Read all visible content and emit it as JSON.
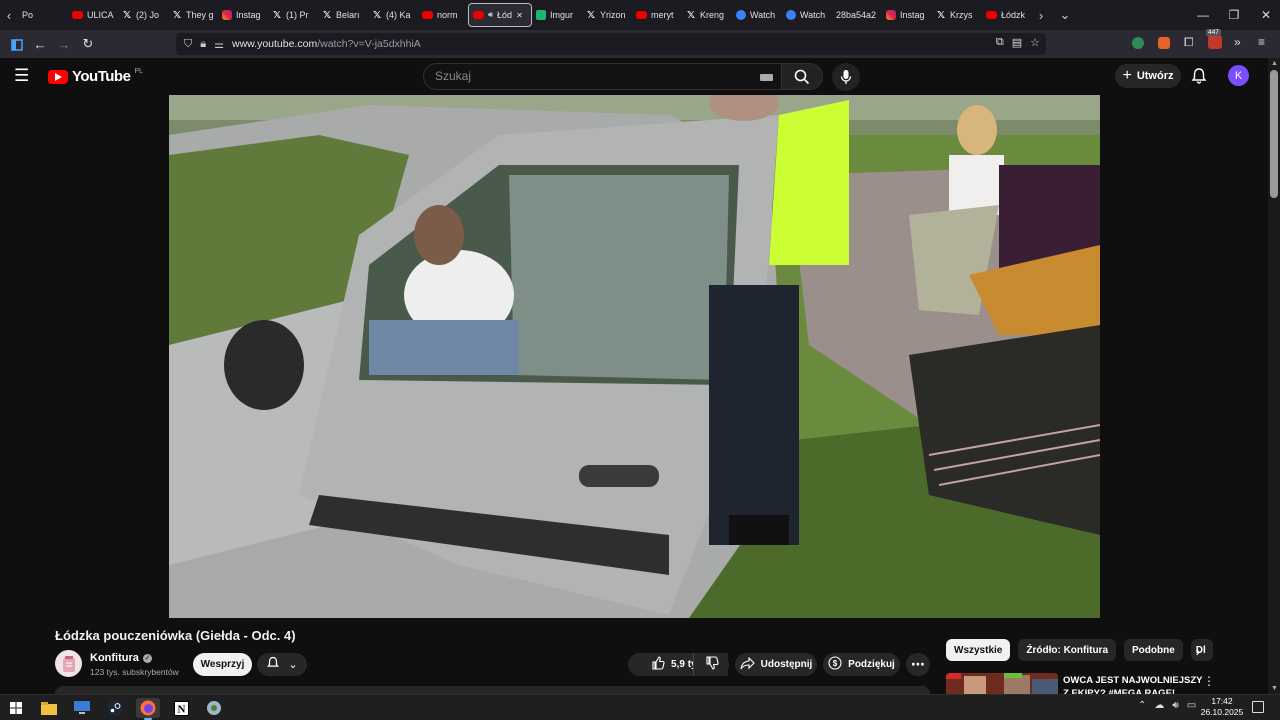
{
  "browser": {
    "tabs": [
      {
        "title": "Po",
        "icon": "none"
      },
      {
        "title": "ULICA",
        "icon": "youtube"
      },
      {
        "title": "(2) Jo",
        "icon": "x"
      },
      {
        "title": "They g",
        "icon": "x"
      },
      {
        "title": "Instag",
        "icon": "instagram"
      },
      {
        "title": "(1) Pr",
        "icon": "x"
      },
      {
        "title": "Beları",
        "icon": "x"
      },
      {
        "title": "(4) Ka",
        "icon": "x"
      },
      {
        "title": "norm",
        "icon": "youtube"
      },
      {
        "title": "Łód",
        "icon": "youtube",
        "active": true
      },
      {
        "title": "Imgur",
        "icon": "imgur"
      },
      {
        "title": "Yrizon",
        "icon": "x"
      },
      {
        "title": "meryt",
        "icon": "youtube"
      },
      {
        "title": "Kreng",
        "icon": "x"
      },
      {
        "title": "Watch",
        "icon": "edge"
      },
      {
        "title": "Watch",
        "icon": "edge"
      },
      {
        "title": "28ba54a2",
        "icon": "none"
      },
      {
        "title": "Instag",
        "icon": "instagram"
      },
      {
        "title": "Krzys",
        "icon": "x"
      },
      {
        "title": "Łódzk",
        "icon": "youtube"
      }
    ],
    "url_host": "www.youtube.com",
    "url_path": "/watch?v=V-ja5dxhhiA",
    "extension_badge": "447"
  },
  "youtube": {
    "logo_text": "YouTube",
    "region": "PL",
    "search_placeholder": "Szukaj",
    "create_label": "Utwórz",
    "avatar_letter": "K"
  },
  "video": {
    "title": "Łódzka pouczeniówka (Giełda - Odc. 4)",
    "channel_name": "Konfitura",
    "subscribers": "123 tys. subskrybentów",
    "support_label": "Wesprzyj",
    "likes": "5,9 tys.",
    "share_label": "Udostępnij",
    "thanks_label": "Podziękuj"
  },
  "sidebar": {
    "chips": [
      "Wszystkie",
      "Źródło: Konfitura",
      "Podobne",
      "Dl"
    ],
    "recommendation_title": "OWCA JEST NAJWOLNIEJSZY Z EKIPY? #MEGA RAGE!"
  },
  "taskbar": {
    "time": "17:42",
    "date": "26.10.2025"
  },
  "colors": {
    "yt_red": "#ff0000",
    "background": "#0f0f0f",
    "chip_bg": "#272727",
    "avatar": "#7c4dff"
  }
}
